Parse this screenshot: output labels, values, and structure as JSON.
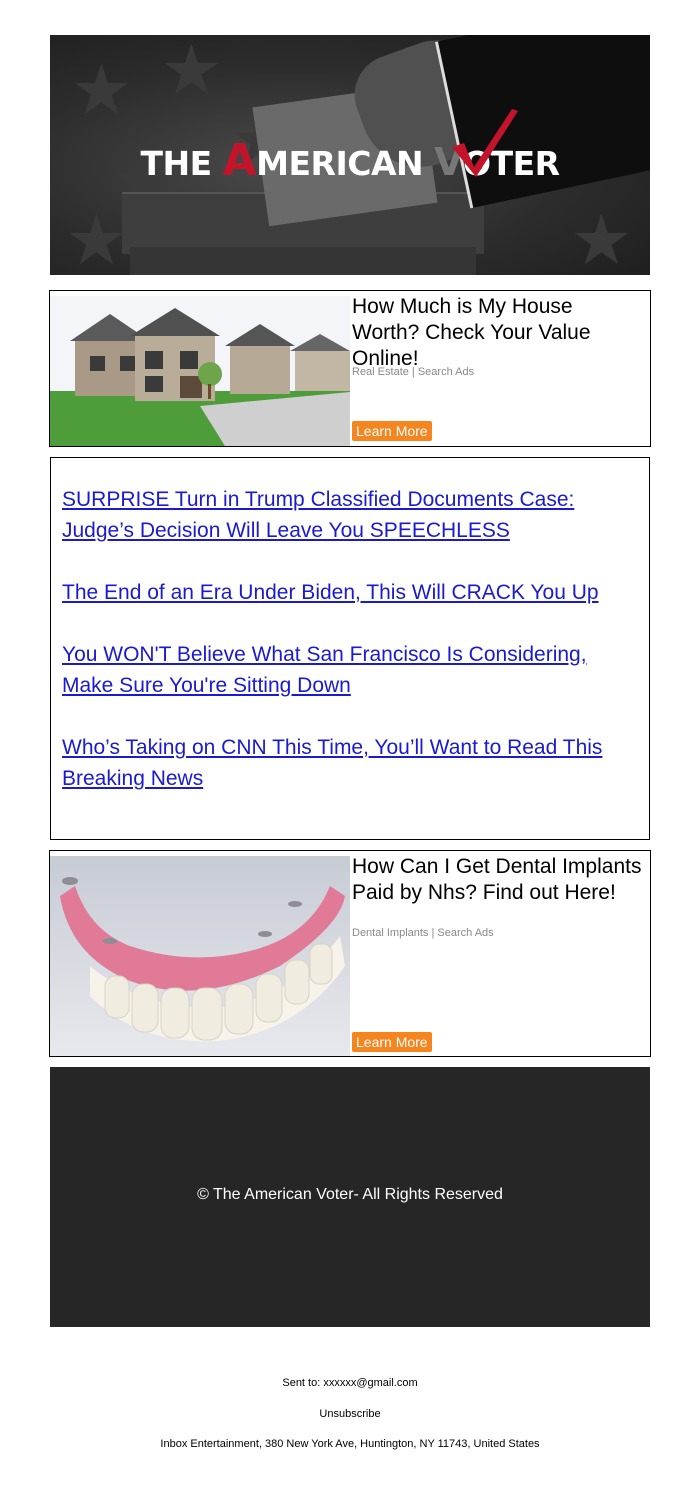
{
  "header": {
    "logo_part1": "THE ",
    "logo_a": "A",
    "logo_part2": "MERICAN ",
    "logo_v": "V",
    "logo_part3": "OTER"
  },
  "ads": [
    {
      "headline": "How Much is My House Worth? Check Your Value Online!",
      "source": "Real Estate | Search Ads",
      "cta": "Learn More",
      "image": "house-photo"
    },
    {
      "headline": "How Can I Get Dental Implants Paid by Nhs? Find out Here!",
      "source": "Dental Implants | Search Ads",
      "cta": "Learn More",
      "image": "dental-implant-photo"
    }
  ],
  "links": [
    "SURPRISE Turn in Trump Classified Documents Case: Judge’s Decision Will Leave You SPEECHLESS",
    "The End of an Era Under Biden, This Will CRACK You Up",
    "You WON'T Believe What San Francisco Is Considering, Make Sure You're Sitting Down",
    "Who’s Taking on CNN This Time, You’ll Want to Read This Breaking News"
  ],
  "footer": {
    "copyright": "© The American Voter- All Rights Reserved",
    "sent_to": "Sent to: xxxxxx@gmail.com",
    "unsubscribe": "Unsubscribe",
    "address": "Inbox Entertainment, 380 New York Ave, Huntington, NY 11743, United States"
  },
  "colors": {
    "cta": "#f5851f",
    "link": "#1a1ad0",
    "logo_red": "#c3142c",
    "footer_bg": "#262626"
  }
}
